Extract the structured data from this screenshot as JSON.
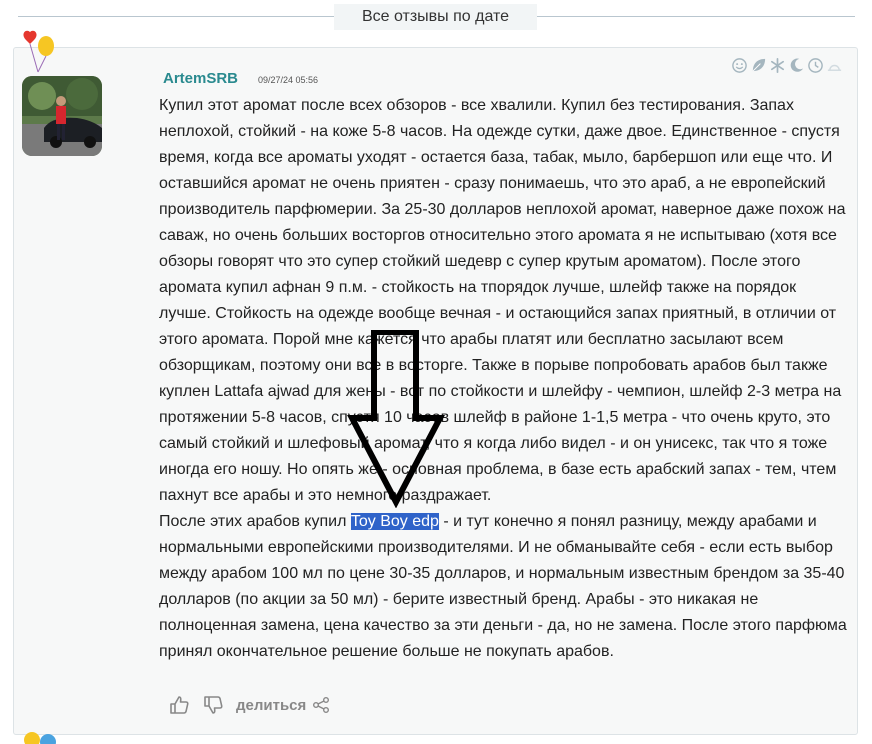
{
  "header": {
    "title": "Все отзывы по дате"
  },
  "review": {
    "username": "ArtemSRB",
    "date": "09/27/24 05:56",
    "badges": [
      "smile-icon",
      "leaf-icon",
      "snowflake-icon",
      "moon-icon",
      "clock-icon",
      "sunset-icon"
    ],
    "paragraph1": "Купил этот аромат после всех обзоров - все хвалили. Купил без тестирования. Запах неплохой, стойкий - на коже 5-8 часов. На одежде сутки, даже двое. Единственное - спустя время, когда все ароматы уходят - остается база, табак, мыло, барбершоп или еще что. И оставшийся аромат не очень приятен - сразу понимаешь, что это араб, а не европейский производитель парфюмерии. За 25-30 долларов неплохой аромат, наверное даже похож на саваж, но очень больших восторгов относительно этого аромата я не испытываю (хотя все обзоры говорят что это супер стойкий шедевр с супер крутым ароматом). После этого аромата купил афнан 9 п.м. - стойкость на тпорядок лучше, шлейф также на порядок лучше. Стойкость на одежде вообще вечная - и остающийся запах приятный, в отличии от этого аромата. Порой мне кажется что арабы платят или бесплатно засылают всем обзорщикам, поэтому они все в восторге. Также в порыве попробовать арабов был также куплен Lattafa ajwad для жены - вот по стойкости и шлейфу - чемпион, шлейф 2-3 метра на протяжении 5-8 часов, спустя 10 часов шлейф в районе 1-1,5 метра - что очень круто, это самый стойкий и шлефовый аромат, что я когда либо видел - и он унисекс, так что я тоже иногда его ношу. Но опять же - основная проблема, в базе есть арабский запах - тем, чтем пахнут все арабы и это немного раздражает.",
    "paragraph2_before": "После этих арабов купил ",
    "paragraph2_link": "Toy Boy edp",
    "paragraph2_after": " - и тут конечно я понял разницу, между арабами и нормальными европейскими производителями. И не обманывайте себя - если есть выбор между арабом 100 мл по цене 30-35 долларов, и нормальным известным брендом за 35-40 долларов (по акции за 50 мл) - берите известный бренд. Арабы - это никакая не полноценная замена, цена качество за эти деньги - да, но не замена. После этого парфюма принял окончательное решение больше не покупать арабов.",
    "share_label": "делиться"
  },
  "colors": {
    "username": "#2a8a8f",
    "highlight": "#2f63c9",
    "card_bg": "#f7f8f8"
  }
}
